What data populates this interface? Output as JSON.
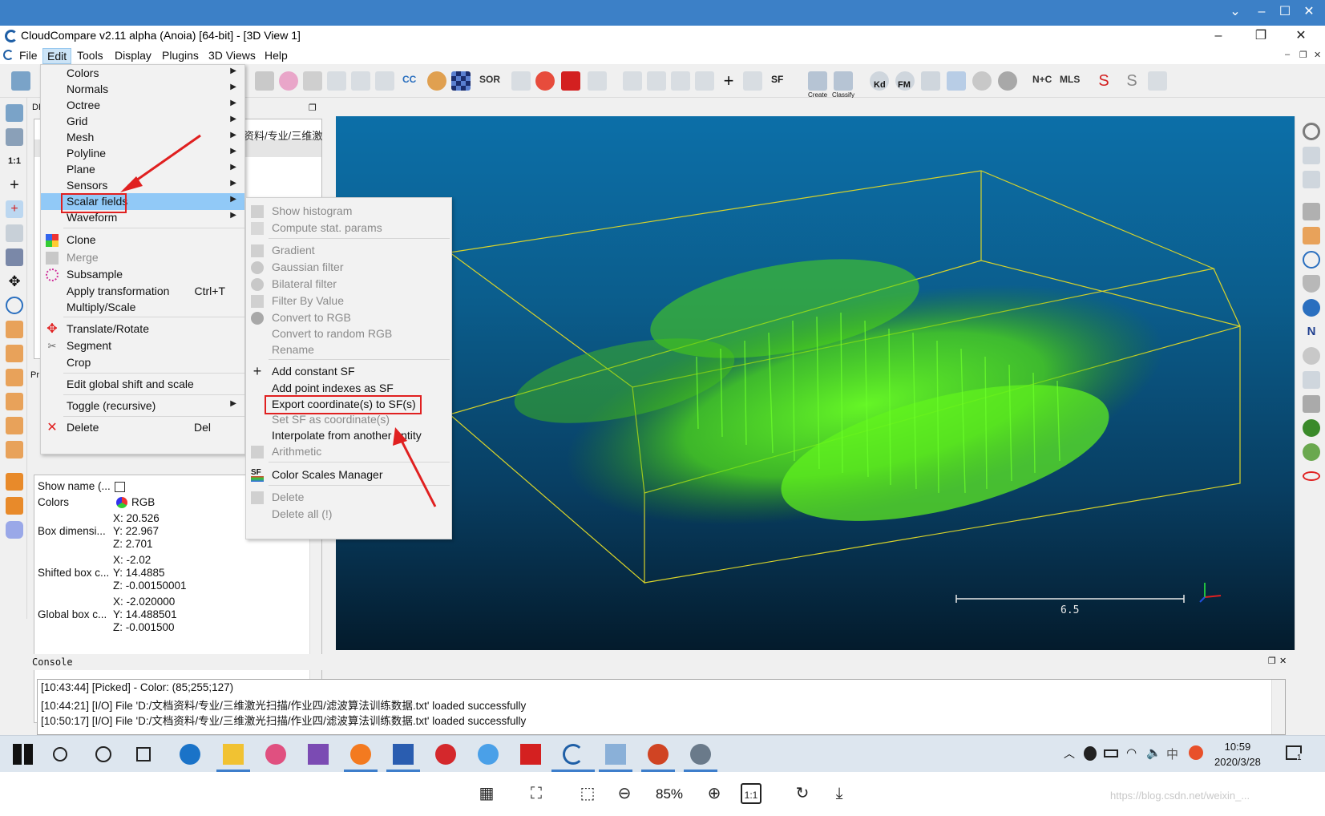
{
  "app": {
    "title": "CloudCompare v2.11 alpha (Anoia) [64-bit] - [3D View 1]"
  },
  "menubar": {
    "items": [
      "File",
      "Edit",
      "Tools",
      "Display",
      "Plugins",
      "3D Views",
      "Help"
    ],
    "active": "Edit"
  },
  "toolbar": {
    "labels": [
      "CC",
      "SOR",
      "SF",
      "Kd",
      "FM",
      "N+C",
      "MLS"
    ],
    "canupo_create": "Create",
    "canupo_classify": "Classify"
  },
  "db_panel": {
    "tab_label": "DB",
    "props_tab_label": "Pr",
    "path_fragment": "资料/专业/三维激"
  },
  "properties": {
    "show_name_label": "Show name (...",
    "colors_label": "Colors",
    "colors_value": "RGB",
    "box_dim_label": "Box dimensi...",
    "box_dim": [
      "X: 20.526",
      "Y: 22.967",
      "Z: 2.701"
    ],
    "shifted_label": "Shifted box c...",
    "shifted": [
      "X: -2.02",
      "Y: 14.4885",
      "Z: -0.00150001"
    ],
    "global_label": "Global box c...",
    "global": [
      "X: -2.020000",
      "Y: 14.488501",
      "Z: -0.001500"
    ]
  },
  "edit_menu": {
    "items": [
      {
        "label": "Colors",
        "submenu": true
      },
      {
        "label": "Normals",
        "submenu": true
      },
      {
        "label": "Octree",
        "submenu": true
      },
      {
        "label": "Grid",
        "submenu": true
      },
      {
        "label": "Mesh",
        "submenu": true
      },
      {
        "label": "Polyline",
        "submenu": true
      },
      {
        "label": "Plane",
        "submenu": true
      },
      {
        "label": "Sensors",
        "submenu": true
      },
      {
        "label": "Scalar fields",
        "submenu": true,
        "highlighted": true
      },
      {
        "label": "Waveform",
        "submenu": true
      },
      {
        "label": "Clone"
      },
      {
        "label": "Merge",
        "disabled": true
      },
      {
        "label": "Subsample"
      },
      {
        "label": "Apply transformation",
        "shortcut": "Ctrl+T"
      },
      {
        "label": "Multiply/Scale"
      },
      {
        "label": "Translate/Rotate"
      },
      {
        "label": "Segment"
      },
      {
        "label": "Crop"
      },
      {
        "label": "Edit global shift and scale"
      },
      {
        "label": "Toggle (recursive)",
        "submenu": true
      },
      {
        "label": "Delete",
        "shortcut": "Del"
      }
    ]
  },
  "scalar_fields_menu": {
    "items": [
      {
        "label": "Show histogram",
        "disabled": true
      },
      {
        "label": "Compute stat. params",
        "disabled": true
      },
      {
        "label": "Gradient",
        "disabled": true
      },
      {
        "label": "Gaussian filter",
        "disabled": true
      },
      {
        "label": "Bilateral filter",
        "disabled": true
      },
      {
        "label": "Filter By Value",
        "disabled": true
      },
      {
        "label": "Convert to RGB",
        "disabled": true
      },
      {
        "label": "Convert to random RGB",
        "disabled": true
      },
      {
        "label": "Rename",
        "disabled": true
      },
      {
        "label": "Add constant SF"
      },
      {
        "label": "Add point indexes as SF"
      },
      {
        "label": "Export coordinate(s) to SF(s)",
        "boxed": true
      },
      {
        "label": "Set SF as coordinate(s)",
        "disabled": true
      },
      {
        "label": "Interpolate from another entity"
      },
      {
        "label": "Arithmetic",
        "disabled": true
      },
      {
        "label": "Color Scales Manager"
      },
      {
        "label": "Delete",
        "disabled": true
      },
      {
        "label": "Delete all (!)",
        "disabled": true
      }
    ]
  },
  "view3d": {
    "scale_label": "6.5"
  },
  "console": {
    "title": "Console",
    "lines": [
      "[10:43:44] [Picked]       - Color: (85;255;127)",
      "[10:44:21] [I/O] File 'D:/文档资料/专业/三维激光扫描/作业四/滤波算法训练数据.txt' loaded successfully",
      "[10:50:17] [I/O] File 'D:/文档资料/专业/三维激光扫描/作业四/滤波算法训练数据.txt' loaded successfully"
    ]
  },
  "taskbar": {
    "time": "10:59",
    "date": "2020/3/28",
    "ime": "中",
    "notif_count": "1"
  },
  "viewer": {
    "zoom": "85%",
    "one_to_one": "1:1",
    "watermark": "https://blog.csdn.net/weixin_..."
  },
  "colors": {
    "accent_red": "#e02020",
    "menu_highlight": "#91c9f7",
    "point_green": "#5cff1c",
    "bbox_yellow": "#d8d32a"
  }
}
